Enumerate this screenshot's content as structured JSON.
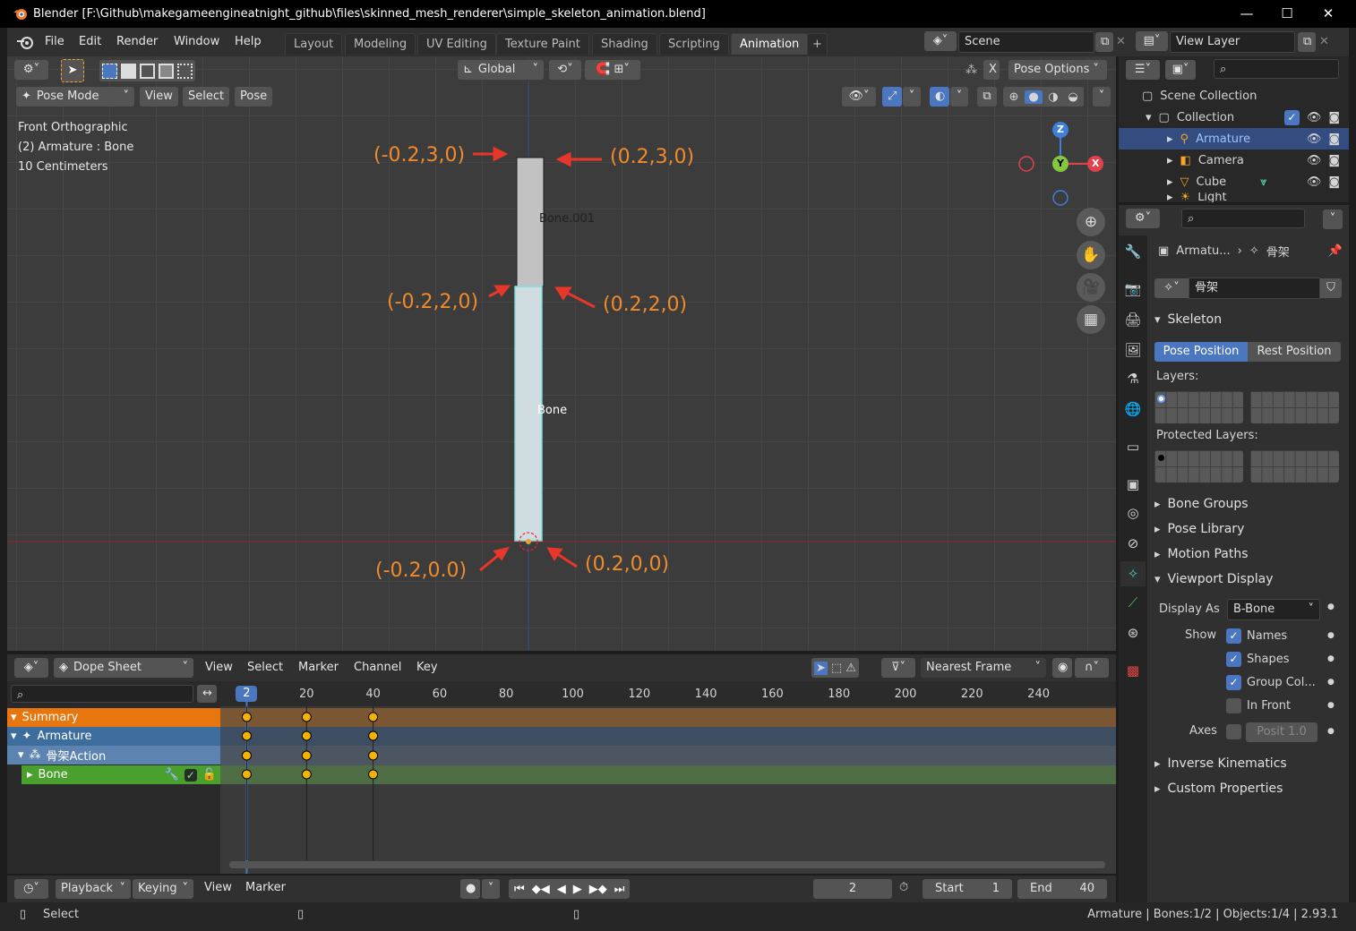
{
  "window": {
    "title": "Blender [F:\\Github\\makegameengineatnight_github\\files\\skinned_mesh_renderer\\simple_skeleton_animation.blend]",
    "minimize": "—",
    "maximize": "☐",
    "close": "✕"
  },
  "menu": [
    "File",
    "Edit",
    "Render",
    "Window",
    "Help"
  ],
  "workspaces": [
    "Layout",
    "Modeling",
    "UV Editing",
    "Texture Paint",
    "Shading",
    "Scripting",
    "Animation"
  ],
  "active_workspace": "Animation",
  "scene": {
    "name": "Scene",
    "view_layer": "View Layer"
  },
  "viewport": {
    "transform_orientation": "Global",
    "pose_options": "Pose Options",
    "mode": "Pose Mode",
    "header_menus": [
      "View",
      "Select",
      "Pose"
    ],
    "overlay_info": [
      "Front Orthographic",
      "(2) Armature : Bone",
      "10 Centimeters"
    ],
    "bones": [
      "Bone.001",
      "Bone"
    ],
    "annotations": [
      "(-0.2,3,0)",
      "(0.2,3,0)",
      "(-0.2,2,0)",
      "(0.2,2,0)",
      "(-0.2,0.0)",
      "(0.2,0,0)"
    ],
    "gizmo_axes": [
      "Z",
      "Y",
      "X"
    ]
  },
  "outliner": {
    "root": "Scene Collection",
    "collection": "Collection",
    "items": [
      "Armature",
      "Camera",
      "Cube",
      "Light"
    ]
  },
  "properties": {
    "breadcrumb_object": "Armatu...",
    "breadcrumb_data": "骨架",
    "data_name": "骨架",
    "skeleton_label": "Skeleton",
    "pose_position": "Pose Position",
    "rest_position": "Rest Position",
    "layers_label": "Layers:",
    "protected_layers_label": "Protected Layers:",
    "collapsed_panels": [
      "Bone Groups",
      "Pose Library",
      "Motion Paths"
    ],
    "viewport_display": "Viewport Display",
    "display_as_label": "Display As",
    "display_as_value": "B-Bone",
    "show_label": "Show",
    "show_options": [
      {
        "label": "Names",
        "checked": true
      },
      {
        "label": "Shapes",
        "checked": true
      },
      {
        "label": "Group Col...",
        "checked": true
      },
      {
        "label": "In Front",
        "checked": false
      }
    ],
    "axes_label": "Axes",
    "axes_value": "Posit  1.0",
    "bottom_panels": [
      "Inverse Kinematics",
      "Custom Properties"
    ]
  },
  "dopesheet": {
    "editor": "Dope Sheet",
    "menus": [
      "View",
      "Select",
      "Marker",
      "Channel",
      "Key"
    ],
    "snap": "Nearest Frame",
    "current_frame": "2",
    "ruler": [
      "20",
      "40",
      "60",
      "80",
      "100",
      "120",
      "140",
      "160",
      "180",
      "200",
      "220",
      "240"
    ],
    "channels": [
      {
        "name": "Summary",
        "color": "#e8760f"
      },
      {
        "name": "Armature",
        "color": "#3c6d9c"
      },
      {
        "name": "骨架Action",
        "color": "#5d83b0"
      },
      {
        "name": "Bone",
        "color": "#4aa02c"
      }
    ],
    "keyframes": [
      2,
      20,
      40
    ]
  },
  "timeline": {
    "menus": [
      "Playback",
      "Keying",
      "View",
      "Marker"
    ],
    "current_frame": "2",
    "start_label": "Start",
    "start": "1",
    "end_label": "End",
    "end": "40"
  },
  "status": {
    "left": "Select",
    "right": "Armature | Bones:1/2 | Objects:1/4 | 2.93.1"
  }
}
